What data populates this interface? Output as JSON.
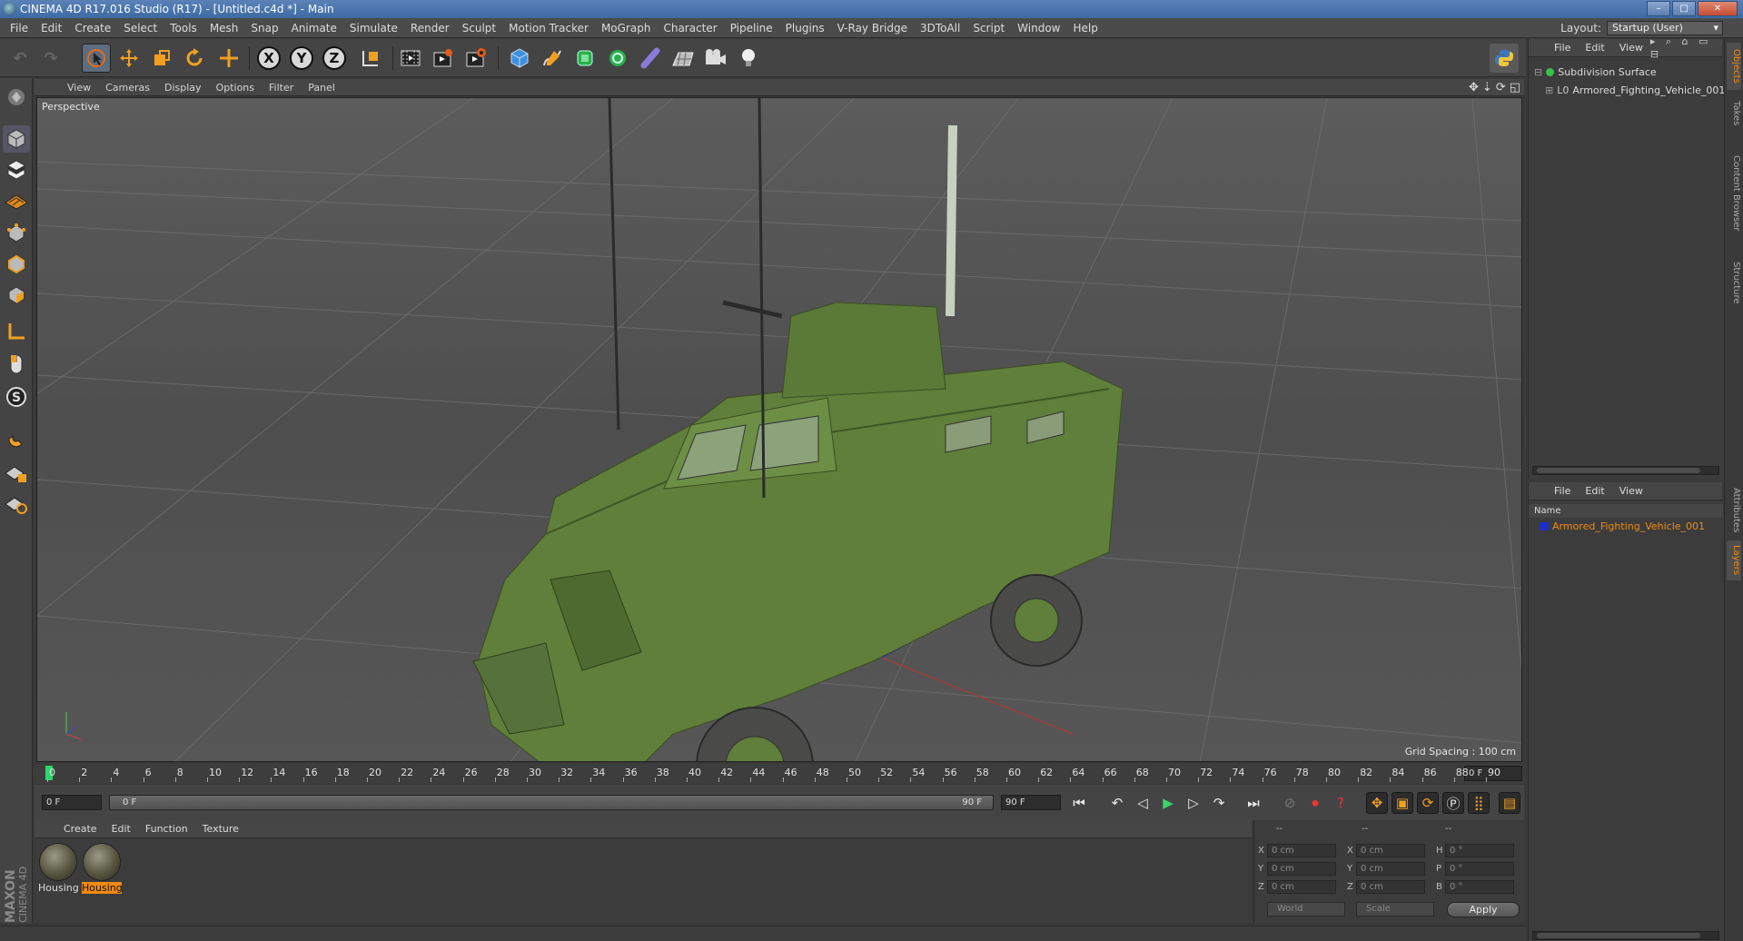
{
  "window": {
    "title": "CINEMA 4D R17.016 Studio (R17) - [Untitled.c4d *] - Main",
    "buttons": [
      "–",
      "□",
      "✕"
    ]
  },
  "menubar": {
    "items": [
      "File",
      "Edit",
      "Create",
      "Select",
      "Tools",
      "Mesh",
      "Snap",
      "Animate",
      "Simulate",
      "Render",
      "Sculpt",
      "Motion Tracker",
      "MoGraph",
      "Character",
      "Pipeline",
      "Plugins",
      "V-Ray Bridge",
      "3DToAll",
      "Script",
      "Window",
      "Help"
    ],
    "layout_label": "Layout:",
    "layout_value": "Startup (User)"
  },
  "toolbar": {
    "axis": [
      "X",
      "Y",
      "Z"
    ]
  },
  "viewport": {
    "menu": [
      "View",
      "Cameras",
      "Display",
      "Options",
      "Filter",
      "Panel"
    ],
    "label": "Perspective",
    "grid_spacing": "Grid Spacing : 100 cm",
    "model_color": "#5f7f3a"
  },
  "timeline": {
    "ticks": [
      "0",
      "2",
      "4",
      "6",
      "8",
      "10",
      "12",
      "14",
      "16",
      "18",
      "20",
      "22",
      "24",
      "26",
      "28",
      "30",
      "32",
      "34",
      "36",
      "38",
      "40",
      "42",
      "44",
      "46",
      "48",
      "50",
      "52",
      "54",
      "56",
      "58",
      "60",
      "62",
      "64",
      "66",
      "68",
      "70",
      "72",
      "74",
      "76",
      "78",
      "80",
      "82",
      "84",
      "86",
      "88",
      "90"
    ],
    "current_frame": "0 F",
    "start_field": "0 F",
    "slider_start": "0 F",
    "slider_end": "90 F",
    "end_field": "90 F"
  },
  "materials": {
    "menu": [
      "Create",
      "Edit",
      "Function",
      "Texture"
    ],
    "items": [
      {
        "label": "Housing",
        "active": false
      },
      {
        "label": "Housing",
        "active": true
      }
    ]
  },
  "coordinates": {
    "headers": [
      "--",
      "--",
      "--"
    ],
    "rows": [
      {
        "a": "X",
        "av": "0 cm",
        "b": "X",
        "bv": "0 cm",
        "c": "H",
        "cv": "0 °"
      },
      {
        "a": "Y",
        "av": "0 cm",
        "b": "Y",
        "bv": "0 cm",
        "c": "P",
        "cv": "0 °"
      },
      {
        "a": "Z",
        "av": "0 cm",
        "b": "Z",
        "bv": "0 cm",
        "c": "B",
        "cv": "0 °"
      }
    ],
    "mode_world": "World",
    "mode_scale": "Scale",
    "apply": "Apply"
  },
  "object_manager": {
    "menu": [
      "File",
      "Edit",
      "View"
    ],
    "objects": [
      {
        "name": "Subdivision Surface",
        "color": "#39c24a"
      },
      {
        "name": "Armored_Fighting_Vehicle_001",
        "color": "#9a9a9a"
      }
    ]
  },
  "layer_manager": {
    "menu": [
      "File",
      "Edit",
      "View"
    ],
    "name_header": "Name",
    "layers": [
      {
        "name": "Armored_Fighting_Vehicle_001",
        "color": "#1e2ec8"
      }
    ]
  },
  "side_tabs": {
    "top": [
      "Objects",
      "Takes",
      "Content Browser",
      "Structure"
    ],
    "bottom": [
      "Attributes",
      "Layers"
    ]
  },
  "logo": {
    "line1": "MAXON",
    "line2": "CINEMA 4D"
  }
}
